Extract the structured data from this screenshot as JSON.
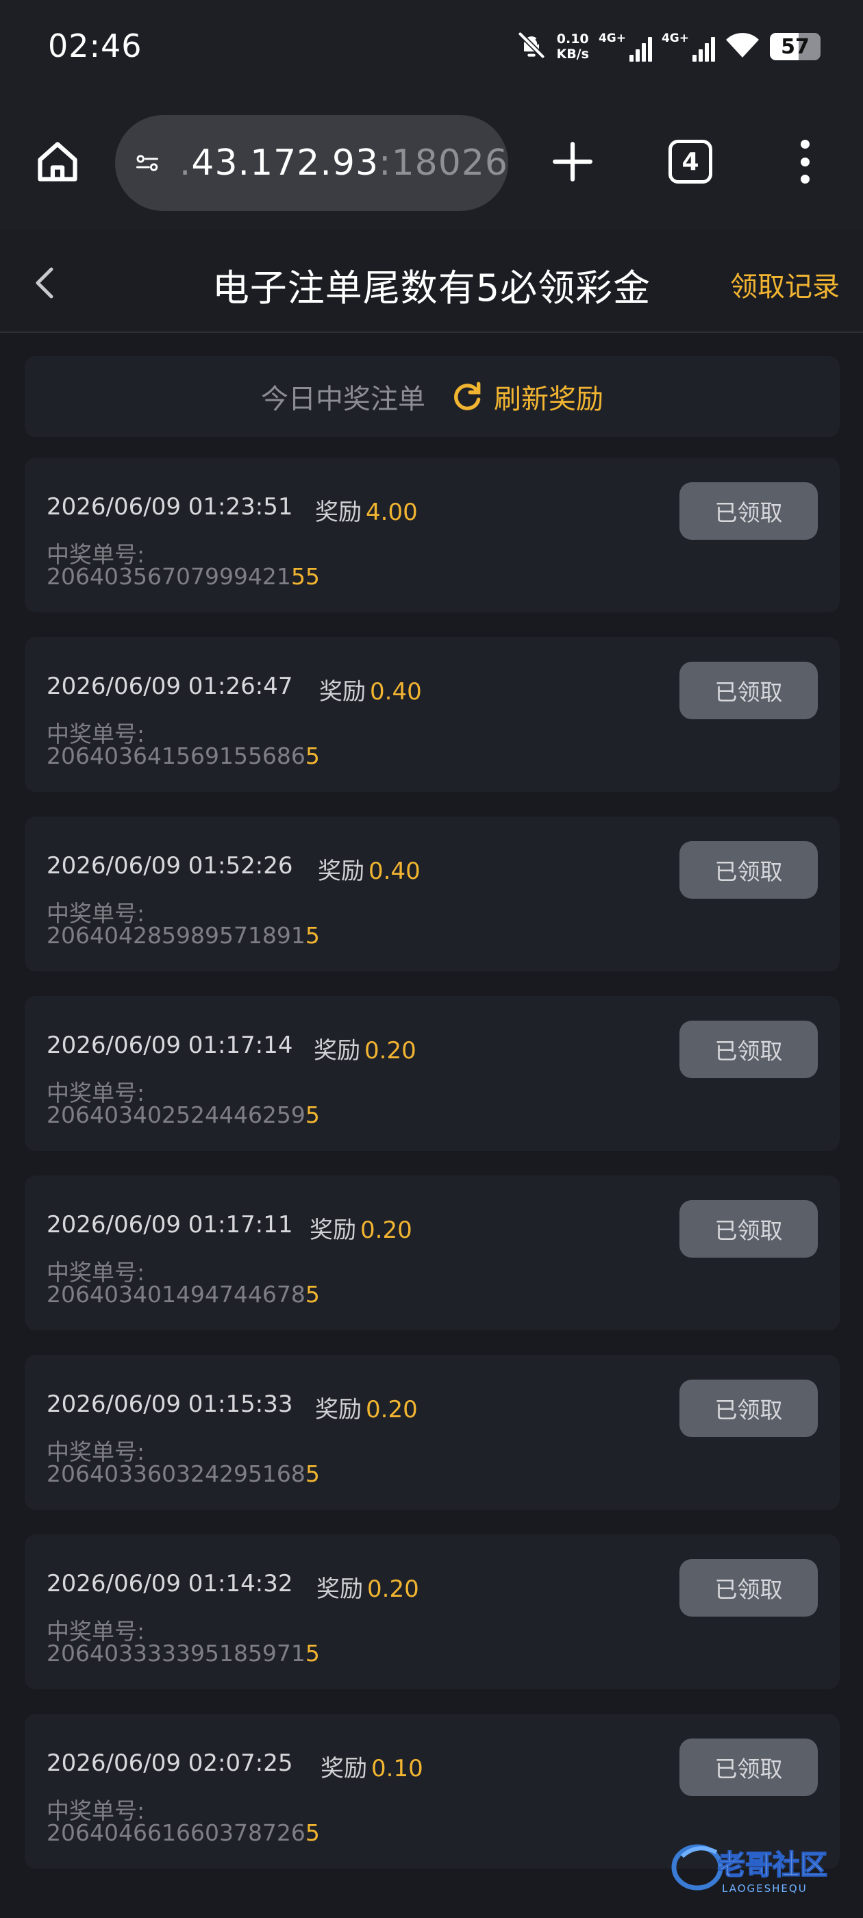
{
  "status_bar": {
    "time": "02:46",
    "speed_value": "0.10",
    "speed_unit": "KB/s",
    "net1_label": "4G+",
    "net2_label": "4G+",
    "battery_level": "57",
    "battery_fraction": 0.57,
    "icons": [
      "bell-muted-icon",
      "signal-icon",
      "wifi-icon",
      "battery-icon"
    ]
  },
  "browser": {
    "url_prefix": ".",
    "url_host": "43.172.93",
    "url_port": ":18026",
    "tab_count": "4"
  },
  "header": {
    "title": "电子注单尾数有5必领彩金",
    "records_link": "领取记录"
  },
  "today": {
    "label": "今日中奖注单",
    "refresh_label": "刷新奖励"
  },
  "colors": {
    "accent": "#f2b531",
    "background": "#181a20",
    "card": "#1f2128",
    "button": "#5c6069"
  },
  "cards": [
    {
      "time": "2026/06/09 01:23:51",
      "reward_label": "奖励",
      "reward": "4.00",
      "order_label": "中奖单号:",
      "order_main": "20640356707999421",
      "order_tail": "55",
      "button": "已领取"
    },
    {
      "time": "2026/06/09 01:26:47",
      "reward_label": "奖励",
      "reward": "0.40",
      "order_label": "中奖单号:",
      "order_main": "20640364156915568​6",
      "order_tail": "5",
      "button": "已领取"
    },
    {
      "time": "2026/06/09 01:52:26",
      "reward_label": "奖励",
      "reward": "0.40",
      "order_label": "中奖单号:",
      "order_main": "206404285989571891",
      "order_tail": "5",
      "button": "已领取"
    },
    {
      "time": "2026/06/09 01:17:14",
      "reward_label": "奖励",
      "reward": "0.20",
      "order_label": "中奖单号:",
      "order_main": "206403402524446259",
      "order_tail": "5",
      "button": "已领取"
    },
    {
      "time": "2026/06/09 01:17:11",
      "reward_label": "奖励",
      "reward": "0.20",
      "order_label": "中奖单号:",
      "order_main": "206403401494744678",
      "order_tail": "5",
      "button": "已领取"
    },
    {
      "time": "2026/06/09 01:15:33",
      "reward_label": "奖励",
      "reward": "0.20",
      "order_label": "中奖单号:",
      "order_main": "206403360324295168",
      "order_tail": "5",
      "button": "已领取"
    },
    {
      "time": "2026/06/09 01:14:32",
      "reward_label": "奖励",
      "reward": "0.20",
      "order_label": "中奖单号:",
      "order_main": "206403333395185971",
      "order_tail": "5",
      "button": "已领取"
    },
    {
      "time": "2026/06/09 02:07:25",
      "reward_label": "奖励",
      "reward": "0.10",
      "order_label": "中奖单号:",
      "order_main": "206404661660378726",
      "order_tail": "5",
      "button": "已领取"
    }
  ],
  "watermark": {
    "text": "老哥社区",
    "sub": "LAOGESHEQU"
  }
}
